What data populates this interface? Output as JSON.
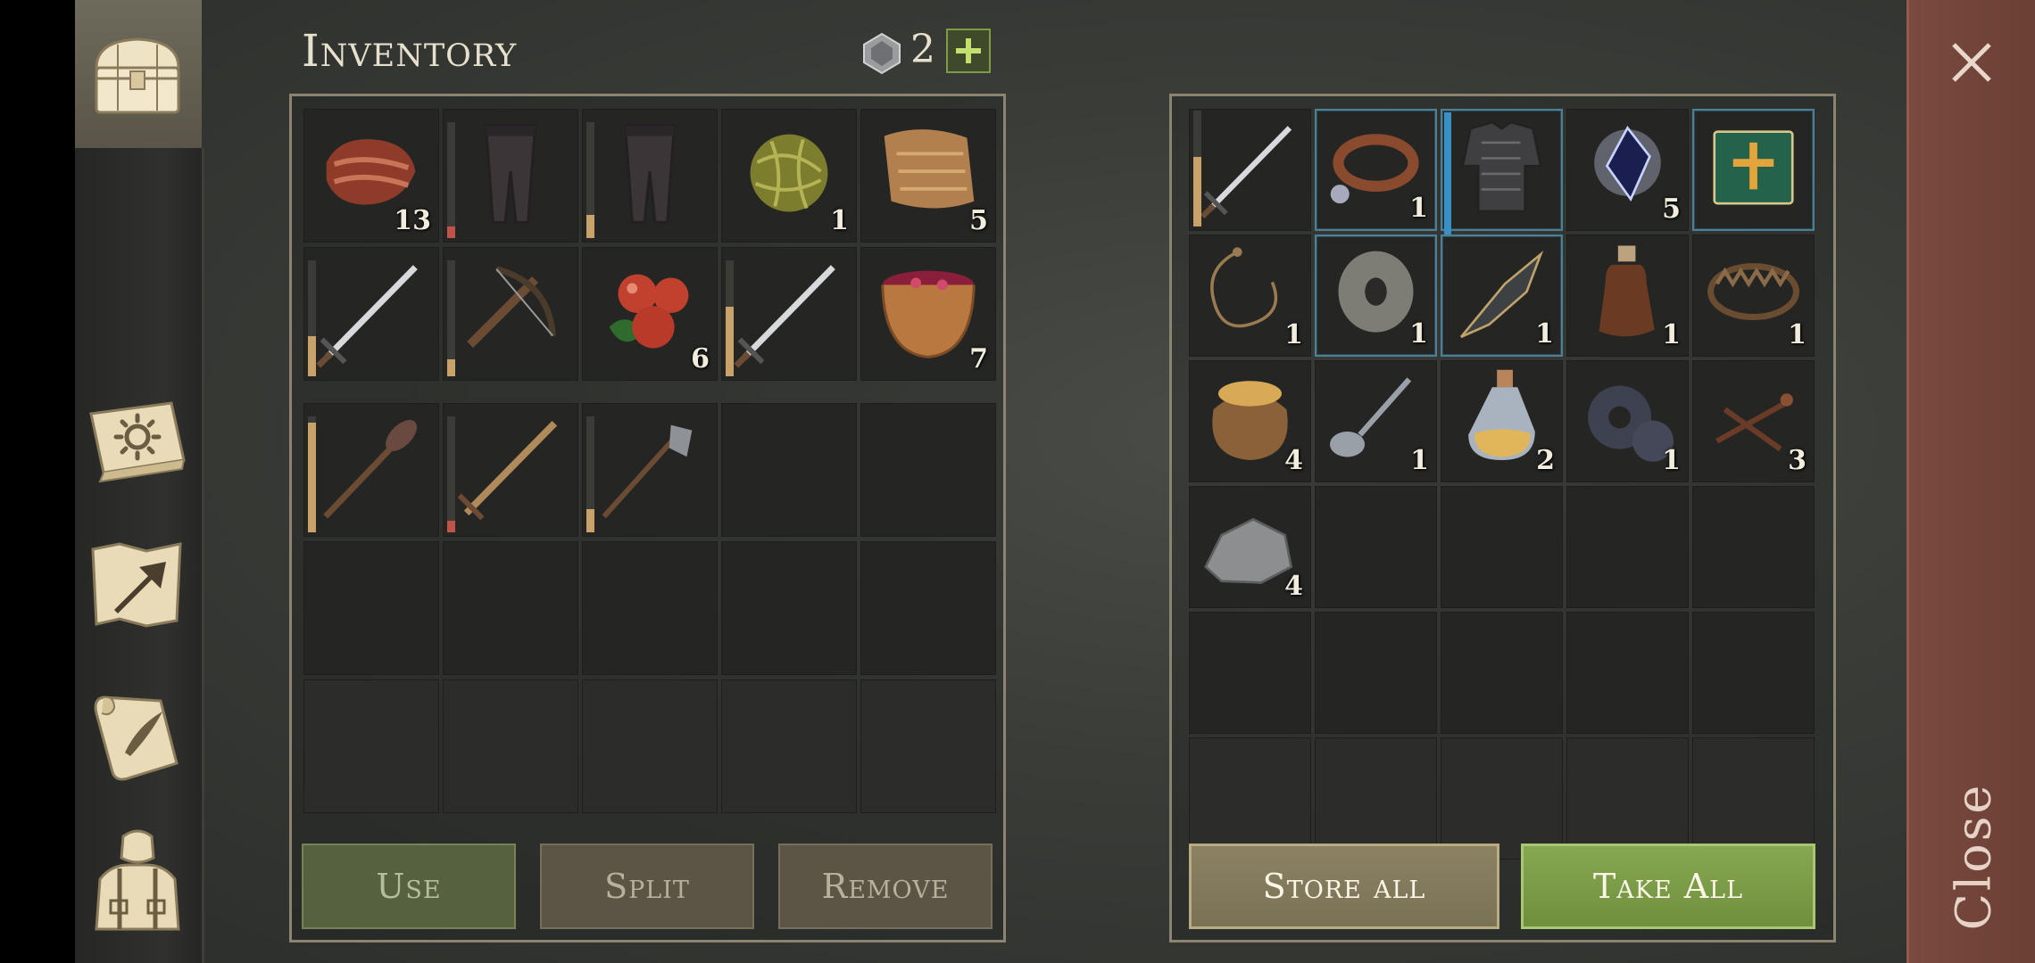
{
  "header": {
    "title": "Inventory",
    "gem_count": "2",
    "add_symbol": "+"
  },
  "sidebar": {
    "tabs": [
      {
        "name": "chest",
        "icon": "chest-icon",
        "active": true
      },
      {
        "name": "journal",
        "icon": "sun-book-icon"
      },
      {
        "name": "map",
        "icon": "map-arrow-icon"
      },
      {
        "name": "scroll",
        "icon": "scroll-quill-icon"
      },
      {
        "name": "character",
        "icon": "character-icon"
      }
    ]
  },
  "inventory": {
    "rows": [
      [
        {
          "icon": "bacon-icon",
          "count": "13"
        },
        {
          "icon": "pants-icon",
          "bar": 0.1,
          "bar_color": "#c0544a"
        },
        {
          "icon": "pants-icon",
          "bar": 0.2,
          "bar_color": "#c9a26a"
        },
        {
          "icon": "fiber-ball-icon",
          "count": "1"
        },
        {
          "icon": "cloth-icon",
          "count": "5"
        }
      ],
      [
        {
          "icon": "sword-icon",
          "bar": 0.35,
          "bar_color": "#c9a26a"
        },
        {
          "icon": "crossbow-icon",
          "bar": 0.15,
          "bar_color": "#c9a26a"
        },
        {
          "icon": "berries-icon",
          "count": "6"
        },
        {
          "icon": "sword-icon",
          "bar": 0.6,
          "bar_color": "#c9a26a"
        },
        {
          "icon": "berry-bowl-icon",
          "count": "7"
        }
      ],
      [
        {
          "icon": "mace-icon",
          "bar": 0.95,
          "bar_color": "#c9a26a"
        },
        {
          "icon": "wooden-sword-icon",
          "bar": 0.1,
          "bar_color": "#c0544a"
        },
        {
          "icon": "halberd-icon",
          "bar": 0.2,
          "bar_color": "#c9a26a"
        },
        {},
        {}
      ],
      [
        {},
        {},
        {},
        {},
        {}
      ],
      [
        {},
        {},
        {},
        {},
        {}
      ]
    ],
    "buttons": {
      "use": "Use",
      "split": "Split",
      "remove": "Remove"
    }
  },
  "container": {
    "rows": [
      [
        {
          "icon": "sword-icon",
          "bar": 0.6,
          "bar_color": "#c9a26a"
        },
        {
          "icon": "collar-icon",
          "count": "1",
          "highlight": true
        },
        {
          "icon": "chainmail-icon",
          "highlight": true,
          "side_bar": true
        },
        {
          "icon": "crystal-icon",
          "count": "5"
        },
        {
          "icon": "green-book-icon",
          "highlight": true
        }
      ],
      [
        {
          "icon": "rope-icon",
          "count": "1"
        },
        {
          "icon": "whetstone-icon",
          "count": "1",
          "highlight": true
        },
        {
          "icon": "blade-fragment-icon",
          "count": "1",
          "highlight": true
        },
        {
          "icon": "bottle-icon",
          "count": "1"
        },
        {
          "icon": "bear-trap-icon",
          "count": "1"
        }
      ],
      [
        {
          "icon": "grain-sack-icon",
          "count": "4"
        },
        {
          "icon": "spoon-icon",
          "count": "1"
        },
        {
          "icon": "potion-icon",
          "count": "2"
        },
        {
          "icon": "gear-icon",
          "count": "1"
        },
        {
          "icon": "nails-icon",
          "count": "3"
        }
      ],
      [
        {
          "icon": "stone-icon",
          "count": "4"
        },
        {},
        {},
        {},
        {}
      ],
      [
        {},
        {},
        {},
        {},
        {}
      ],
      [
        {},
        {},
        {},
        {},
        {}
      ]
    ],
    "buttons": {
      "store_all": "Store all",
      "take_all": "Take All"
    }
  },
  "close": {
    "label": "Close",
    "x_symbol": "✕"
  }
}
